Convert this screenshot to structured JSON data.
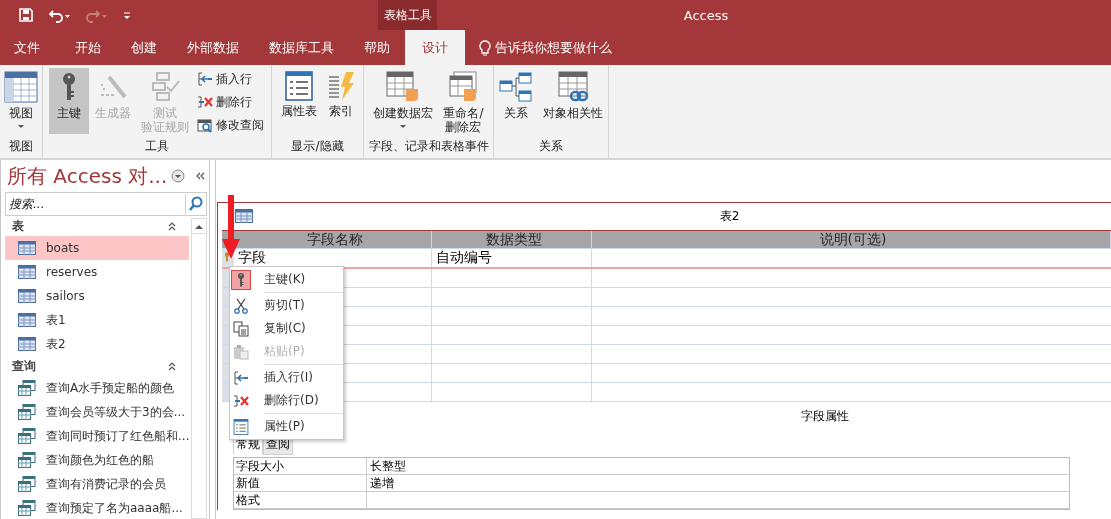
{
  "quick_access": [
    {
      "kind": "save",
      "disabled": false
    },
    {
      "kind": "undo",
      "disabled": false
    },
    {
      "kind": "redo",
      "disabled": true
    },
    {
      "kind": "customize",
      "disabled": false
    }
  ],
  "window": {
    "title": "Access",
    "context_group": "表格工具"
  },
  "tabs": [
    {
      "label": "文件",
      "selected": false
    },
    {
      "label": "开始",
      "selected": false
    },
    {
      "label": "创建",
      "selected": false
    },
    {
      "label": "外部数据",
      "selected": false
    },
    {
      "label": "数据库工具",
      "selected": false
    },
    {
      "label": "帮助",
      "selected": false
    },
    {
      "label": "设计",
      "selected": true
    }
  ],
  "tell_me": "告诉我你想要做什么",
  "ribbon_groups": [
    {
      "label": "视图",
      "buttons": [
        {
          "kind": "large",
          "lines": [
            "视图"
          ],
          "dropdown": true,
          "selected": false,
          "disabled": false
        }
      ]
    },
    {
      "label": "工具",
      "buttons": [
        {
          "kind": "large",
          "lines": [
            "主键"
          ],
          "dropdown": false,
          "selected": true,
          "disabled": false
        },
        {
          "kind": "large",
          "lines": [
            "生成器"
          ],
          "dropdown": false,
          "selected": false,
          "disabled": true
        },
        {
          "kind": "large",
          "lines": [
            "测试",
            "验证规则"
          ],
          "dropdown": false,
          "selected": false,
          "disabled": true
        },
        {
          "kind": "small",
          "lines": [
            "插入行"
          ],
          "dropdown": false,
          "selected": false,
          "disabled": false
        },
        {
          "kind": "small",
          "lines": [
            "删除行"
          ],
          "dropdown": false,
          "selected": false,
          "disabled": false
        },
        {
          "kind": "small",
          "lines": [
            "修改查阅"
          ],
          "dropdown": false,
          "selected": false,
          "disabled": false
        }
      ]
    },
    {
      "label": "显示/隐藏",
      "buttons": [
        {
          "kind": "large",
          "lines": [
            "属性表"
          ],
          "dropdown": false,
          "selected": false,
          "disabled": false
        },
        {
          "kind": "large",
          "lines": [
            "索引"
          ],
          "dropdown": false,
          "selected": false,
          "disabled": false
        }
      ]
    },
    {
      "label": "字段、记录和表格事件",
      "buttons": [
        {
          "kind": "large",
          "lines": [
            "创建数据宏"
          ],
          "dropdown": true,
          "selected": false,
          "disabled": false
        },
        {
          "kind": "large",
          "lines": [
            "重命名/",
            "删除宏"
          ],
          "dropdown": false,
          "selected": false,
          "disabled": false
        }
      ]
    },
    {
      "label": "关系",
      "buttons": [
        {
          "kind": "large",
          "lines": [
            "关系"
          ],
          "dropdown": false,
          "selected": false,
          "disabled": false
        },
        {
          "kind": "large",
          "lines": [
            "对象相关性"
          ],
          "dropdown": false,
          "selected": false,
          "disabled": false
        }
      ]
    }
  ],
  "nav": {
    "title": "所有 Access 对...",
    "search": {
      "placeholder": "搜索..."
    },
    "groups": [
      {
        "label": "表",
        "expanded": true,
        "items": [
          {
            "label": "boats",
            "kind": "table",
            "selected": true
          },
          {
            "label": "reserves",
            "kind": "table",
            "selected": false
          },
          {
            "label": "sailors",
            "kind": "table",
            "selected": false
          },
          {
            "label": "表1",
            "kind": "table",
            "selected": false
          },
          {
            "label": "表2",
            "kind": "table",
            "selected": false
          }
        ]
      },
      {
        "label": "查询",
        "expanded": true,
        "items": [
          {
            "label": "查询A水手预定船的颜色",
            "kind": "query",
            "selected": false
          },
          {
            "label": "查询会员等级大于3的会...",
            "kind": "query",
            "selected": false
          },
          {
            "label": "查询同时预订了红色船和...",
            "kind": "query",
            "selected": false
          },
          {
            "label": "查询颜色为红色的船",
            "kind": "query",
            "selected": false
          },
          {
            "label": "查询有消费记录的会员",
            "kind": "query",
            "selected": false
          },
          {
            "label": "查询预定了名为aaaa船...",
            "kind": "query",
            "selected": false
          }
        ]
      }
    ]
  },
  "designer": {
    "title": "表2",
    "columns": [
      "字段名称",
      "数据类型",
      "说明(可选)"
    ],
    "rows": [
      {
        "field_name": "字段",
        "data_type": "自动编号",
        "primary_key": true,
        "selected": true
      }
    ],
    "field_properties": {
      "label": "字段属性",
      "tabs": [
        {
          "label": "常规",
          "selected": true
        },
        {
          "label": "查阅",
          "selected": false
        }
      ],
      "rows": [
        {
          "name": "字段大小",
          "value": "长整型"
        },
        {
          "name": "新值",
          "value": "递增"
        },
        {
          "name": "格式"
        }
      ]
    }
  },
  "context_menu": {
    "items": [
      {
        "kind": "item",
        "label": "主键(K)",
        "checked": true,
        "disabled": false
      },
      {
        "kind": "separator"
      },
      {
        "kind": "item",
        "label": "剪切(T)",
        "checked": false,
        "disabled": false
      },
      {
        "kind": "item",
        "label": "复制(C)",
        "checked": false,
        "disabled": false
      },
      {
        "kind": "item",
        "label": "粘贴(P)",
        "checked": false,
        "disabled": true
      },
      {
        "kind": "separator"
      },
      {
        "kind": "item",
        "label": "插入行(I)",
        "checked": false,
        "disabled": false
      },
      {
        "kind": "item",
        "label": "删除行(D)",
        "checked": false,
        "disabled": false
      },
      {
        "kind": "separator"
      },
      {
        "kind": "item",
        "label": "属性(P)",
        "checked": false,
        "disabled": false
      }
    ]
  }
}
